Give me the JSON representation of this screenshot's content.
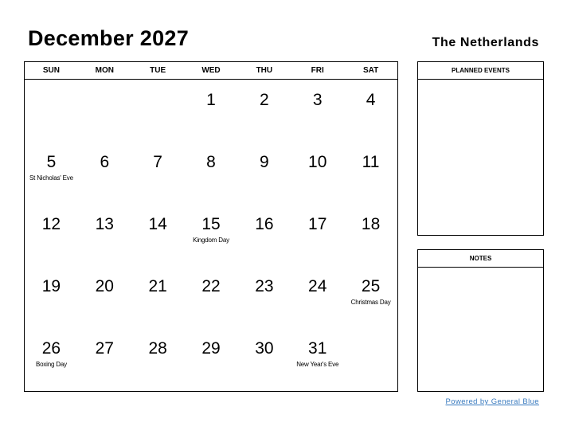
{
  "header": {
    "title": "December 2027",
    "country": "The Netherlands"
  },
  "calendar": {
    "weekdays": [
      "SUN",
      "MON",
      "TUE",
      "WED",
      "THU",
      "FRI",
      "SAT"
    ],
    "weeks": [
      [
        {
          "day": "",
          "holiday": ""
        },
        {
          "day": "",
          "holiday": ""
        },
        {
          "day": "",
          "holiday": ""
        },
        {
          "day": "1",
          "holiday": ""
        },
        {
          "day": "2",
          "holiday": ""
        },
        {
          "day": "3",
          "holiday": ""
        },
        {
          "day": "4",
          "holiday": ""
        }
      ],
      [
        {
          "day": "5",
          "holiday": "St Nicholas' Eve"
        },
        {
          "day": "6",
          "holiday": ""
        },
        {
          "day": "7",
          "holiday": ""
        },
        {
          "day": "8",
          "holiday": ""
        },
        {
          "day": "9",
          "holiday": ""
        },
        {
          "day": "10",
          "holiday": ""
        },
        {
          "day": "11",
          "holiday": ""
        }
      ],
      [
        {
          "day": "12",
          "holiday": ""
        },
        {
          "day": "13",
          "holiday": ""
        },
        {
          "day": "14",
          "holiday": ""
        },
        {
          "day": "15",
          "holiday": "Kingdom Day"
        },
        {
          "day": "16",
          "holiday": ""
        },
        {
          "day": "17",
          "holiday": ""
        },
        {
          "day": "18",
          "holiday": ""
        }
      ],
      [
        {
          "day": "19",
          "holiday": ""
        },
        {
          "day": "20",
          "holiday": ""
        },
        {
          "day": "21",
          "holiday": ""
        },
        {
          "day": "22",
          "holiday": ""
        },
        {
          "day": "23",
          "holiday": ""
        },
        {
          "day": "24",
          "holiday": ""
        },
        {
          "day": "25",
          "holiday": "Christmas Day"
        }
      ],
      [
        {
          "day": "26",
          "holiday": "Boxing Day"
        },
        {
          "day": "27",
          "holiday": ""
        },
        {
          "day": "28",
          "holiday": ""
        },
        {
          "day": "29",
          "holiday": ""
        },
        {
          "day": "30",
          "holiday": ""
        },
        {
          "day": "31",
          "holiday": "New Year's Eve"
        },
        {
          "day": "",
          "holiday": ""
        }
      ]
    ]
  },
  "sidebar": {
    "planned_events_label": "PLANNED EVENTS",
    "notes_label": "NOTES"
  },
  "footer": {
    "powered_by": "Powered by General Blue",
    "link_color": "#3a7bbf"
  }
}
